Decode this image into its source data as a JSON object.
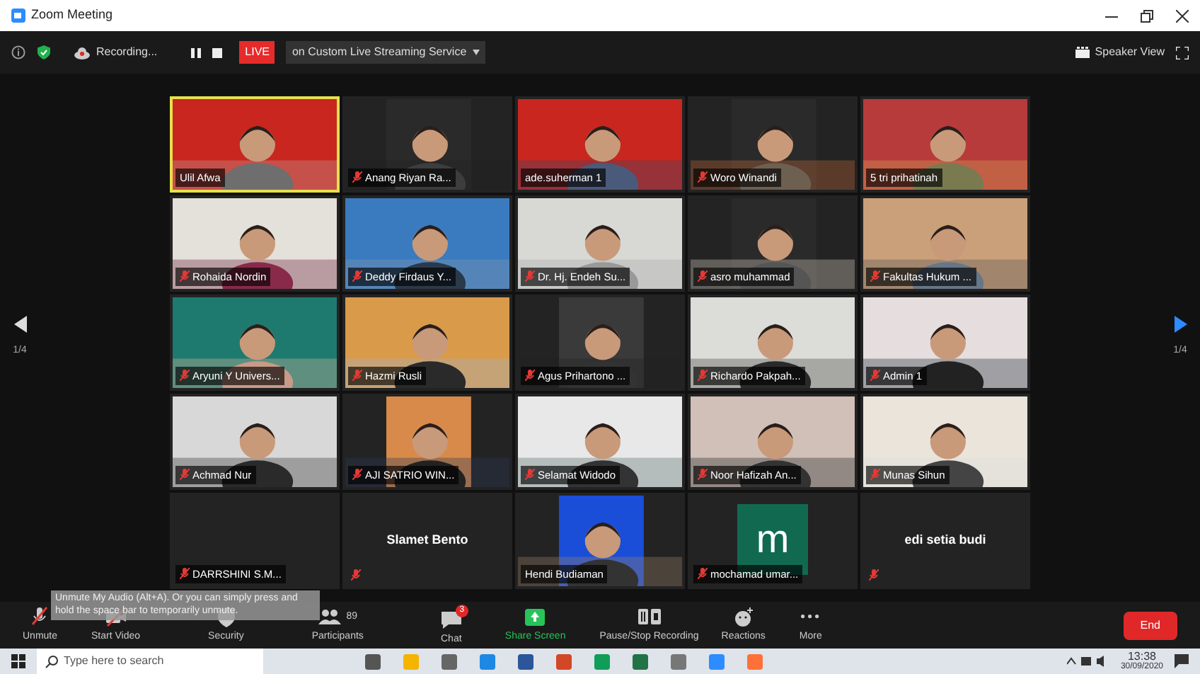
{
  "window": {
    "title": "Zoom Meeting"
  },
  "top_bar": {
    "recording": "Recording...",
    "live": "LIVE",
    "stream": "on Custom Live Streaming Service",
    "view": "Speaker View"
  },
  "pager": {
    "left": "1/4",
    "right": "1/4"
  },
  "tiles": [
    {
      "kind": "video",
      "name": "Ulil Afwa",
      "muted": false,
      "speaking": true
    },
    {
      "kind": "video",
      "name": "Anang Riyan Ra...",
      "muted": true,
      "speaking": false
    },
    {
      "kind": "video",
      "name": "ade.suherman 1",
      "muted": false,
      "speaking": false
    },
    {
      "kind": "video",
      "name": "Woro Winandi",
      "muted": true,
      "speaking": false
    },
    {
      "kind": "video",
      "name": "5 tri prihatinah",
      "muted": false,
      "speaking": false
    },
    {
      "kind": "video",
      "name": "Rohaida Nordin",
      "muted": true,
      "speaking": false
    },
    {
      "kind": "video",
      "name": "Deddy Firdaus Y...",
      "muted": true,
      "speaking": false
    },
    {
      "kind": "video",
      "name": "Dr. Hj. Endeh Su...",
      "muted": true,
      "speaking": false
    },
    {
      "kind": "video",
      "name": "asro muhammad",
      "muted": true,
      "speaking": false
    },
    {
      "kind": "video",
      "name": "Fakultas Hukum ...",
      "muted": true,
      "speaking": false
    },
    {
      "kind": "video",
      "name": "Aryuni  Y Univers...",
      "muted": true,
      "speaking": false
    },
    {
      "kind": "video",
      "name": "Hazmi Rusli",
      "muted": true,
      "speaking": false
    },
    {
      "kind": "video",
      "name": "Agus Prihartono ...",
      "muted": true,
      "speaking": false
    },
    {
      "kind": "video",
      "name": "Richardo Pakpah...",
      "muted": true,
      "speaking": false
    },
    {
      "kind": "video",
      "name": "Admin 1",
      "muted": true,
      "speaking": false
    },
    {
      "kind": "video",
      "name": "Achmad Nur",
      "muted": true,
      "speaking": false
    },
    {
      "kind": "video",
      "name": "AJI SATRIO WIN...",
      "muted": true,
      "speaking": false
    },
    {
      "kind": "video",
      "name": "Selamat Widodo",
      "muted": true,
      "speaking": false
    },
    {
      "kind": "video",
      "name": "Noor Hafizah An...",
      "muted": true,
      "speaking": false
    },
    {
      "kind": "video",
      "name": "Munas Sihun",
      "muted": true,
      "speaking": false
    },
    {
      "kind": "name",
      "name": "DARRSHINI S.M...",
      "muted": true,
      "speaking": false
    },
    {
      "kind": "name",
      "display_name": "Slamet Bento",
      "muted": true,
      "speaking": false
    },
    {
      "kind": "video",
      "name": "Hendi Budiaman",
      "muted": false,
      "speaking": false
    },
    {
      "kind": "avatar",
      "letter": "m",
      "name": "mochamad umar...",
      "muted": true,
      "speaking": false
    },
    {
      "kind": "name",
      "display_name": "edi setia budi",
      "muted": true,
      "speaking": false
    }
  ],
  "tooltip": "Unmute My Audio (Alt+A). Or you can simply press and hold the space bar to temporarily unmute.",
  "toolbar": [
    {
      "kind": "unmute",
      "label": "Unmute"
    },
    {
      "kind": "video",
      "label": "Start Video"
    },
    {
      "kind": "security",
      "label": "Security"
    },
    {
      "kind": "participants",
      "label": "Participants",
      "count": "89"
    },
    {
      "kind": "chat",
      "label": "Chat",
      "badge": "3"
    },
    {
      "kind": "share",
      "label": "Share Screen"
    },
    {
      "kind": "record",
      "label": "Pause/Stop Recording"
    },
    {
      "kind": "reactions",
      "label": "Reactions"
    },
    {
      "kind": "more",
      "label": "More"
    }
  ],
  "end_button": "End",
  "taskbar": {
    "search_placeholder": "Type here to search",
    "time": "13:38",
    "date": "30/09/2020"
  }
}
